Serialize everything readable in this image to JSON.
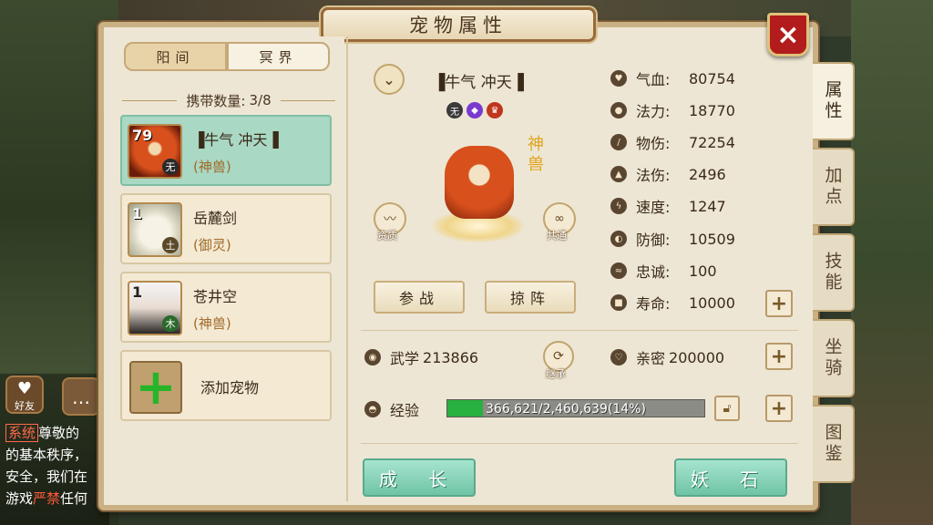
{
  "window": {
    "title": "宠物属性",
    "close_icon": "×"
  },
  "realm_tabs": [
    {
      "label": "阳间",
      "active": true
    },
    {
      "label": "冥界",
      "active": false
    }
  ],
  "capacity": {
    "label": "携带数量:",
    "value": "3/8"
  },
  "pets": [
    {
      "level": "79",
      "element": "无",
      "name": "▐牛气 冲天▐",
      "type": "(神兽)",
      "selected": true
    },
    {
      "level": "1",
      "element": "土",
      "name": "岳麓剑",
      "type": "(御灵)",
      "selected": false
    },
    {
      "level": "1",
      "element": "木",
      "name": "苍井空",
      "type": "(神兽)",
      "selected": false
    }
  ],
  "add_pet_label": "添加宠物",
  "detail": {
    "name": "▐牛气 冲天▐",
    "attr_badges": [
      "无",
      "",
      ""
    ],
    "divine_tag": "神兽",
    "aptitude_label": "资质",
    "common_label": "共通",
    "battle_button": "参战",
    "formation_button": "掠阵"
  },
  "stats": [
    {
      "icon": "heart-icon",
      "label": "气血:",
      "value": "80754"
    },
    {
      "icon": "drop-icon",
      "label": "法力:",
      "value": "18770"
    },
    {
      "icon": "sword-icon",
      "label": "物伤:",
      "value": "72254"
    },
    {
      "icon": "flame-icon",
      "label": "法伤:",
      "value": "2496"
    },
    {
      "icon": "bolt-icon",
      "label": "速度:",
      "value": "1247"
    },
    {
      "icon": "shield-icon",
      "label": "防御:",
      "value": "10509"
    },
    {
      "icon": "loyalty-icon",
      "label": "忠诚:",
      "value": "100"
    },
    {
      "icon": "lifespan-icon",
      "label": "寿命:",
      "value": "10000"
    }
  ],
  "martial": {
    "label": "武学",
    "value": "213866"
  },
  "inherit_label": "继承",
  "intimacy": {
    "label": "亲密",
    "value": "200000"
  },
  "experience": {
    "label": "经验",
    "text": "366,621/2,460,639(14%)",
    "percent": 14
  },
  "bottom_buttons": {
    "grow": "成 长",
    "demon_stone": "妖 石"
  },
  "side_tabs": [
    {
      "label": "属性",
      "active": true
    },
    {
      "label": "加点",
      "active": false
    },
    {
      "label": "技能",
      "active": false
    },
    {
      "label": "坐骑",
      "active": false
    },
    {
      "label": "图鉴",
      "active": false
    }
  ],
  "chat": {
    "friends_label": "好友",
    "line1_tag": "系统",
    "line1": "尊敬的",
    "line2": "的基本秩序，",
    "line3": "安全，我们在",
    "line4a": "游戏",
    "line4b": "严禁",
    "line4c": "任何"
  },
  "colors": {
    "accent_green": "#28b040",
    "panel_bg": "#ede6d4",
    "close_red": "#b21c1c",
    "selected_card": "#a9d8c4"
  }
}
